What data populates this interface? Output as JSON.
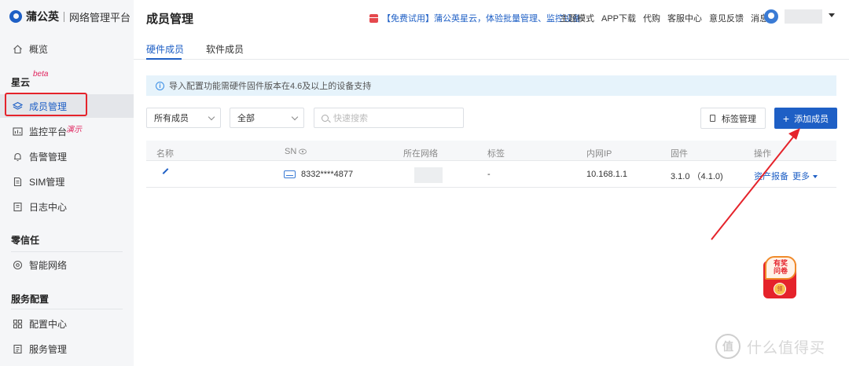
{
  "logo": {
    "brand": "蒲公英",
    "subtitle": "网络管理平台"
  },
  "sidebar": {
    "overview": "概览",
    "section_xingyun": "星云",
    "beta": "beta",
    "members": "成员管理",
    "monitor": "监控平台",
    "demo": "演示",
    "alerts": "告警管理",
    "sim": "SIM管理",
    "logs": "日志中心",
    "section_zero_trust": "零信任",
    "smart_network": "智能网络",
    "section_service": "服务配置",
    "config_center": "配置中心",
    "service_mgmt": "服务管理"
  },
  "header": {
    "title": "成员管理",
    "promo": "【免费试用】蒲公英星云，体验批量管理、监控设备",
    "links": [
      "主题模式",
      "APP下载",
      "代购",
      "客服中心",
      "意见反馈",
      "消息"
    ]
  },
  "tabs": [
    "硬件成员",
    "软件成员"
  ],
  "notice": "导入配置功能需硬件固件版本在4.6及以上的设备支持",
  "filters": {
    "member_select": "所有成员",
    "status_select": "全部",
    "search_placeholder": "快速搜索"
  },
  "actions": {
    "tag_mgmt": "标签管理",
    "add_member": "添加成员"
  },
  "table": {
    "headers": [
      "名称",
      "SN",
      "所在网络",
      "标签",
      "内网IP",
      "固件",
      "操作"
    ],
    "rows": [
      {
        "sn": "8332****4877",
        "tag": "-",
        "ip": "10.168.1.1",
        "firmware": "3.1.0 （4.1.0)",
        "op_report": "资产报备",
        "op_more": "更多"
      }
    ]
  },
  "promo_badge": {
    "line1": "有奖",
    "line2": "问卷",
    "coin": "领"
  },
  "watermark": {
    "symbol": "值",
    "text": "什么值得买"
  },
  "colors": {
    "accent": "#1e5fc5",
    "highlight": "#e5232b"
  }
}
